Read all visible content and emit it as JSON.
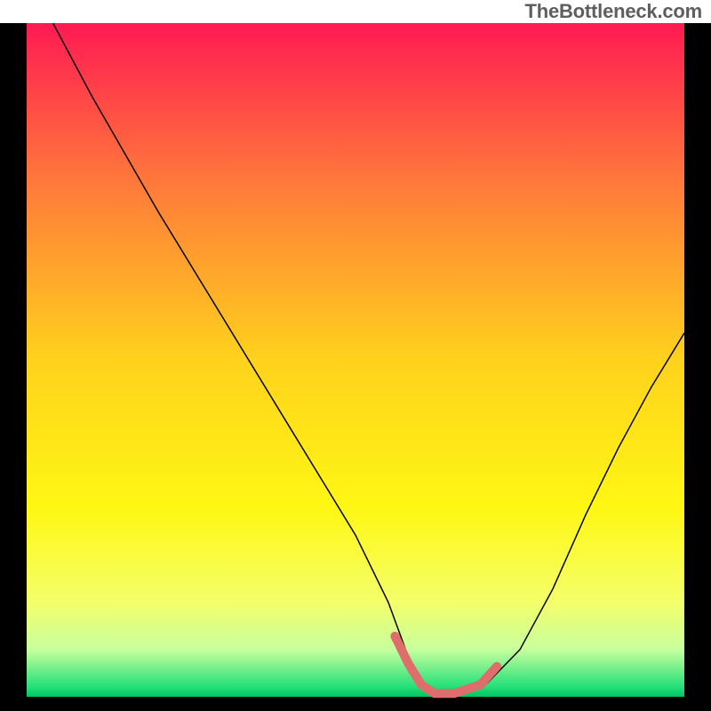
{
  "attribution": "TheBottleneck.com",
  "chart_data": {
    "type": "line",
    "title": "",
    "xlabel": "",
    "ylabel": "",
    "xlim": [
      0,
      100
    ],
    "ylim": [
      0,
      100
    ],
    "grid": false,
    "legend": false,
    "annotations": [],
    "background_gradient": {
      "stops": [
        {
          "offset": 0.0,
          "color": "#ff1a53"
        },
        {
          "offset": 0.25,
          "color": "#ff7e39"
        },
        {
          "offset": 0.5,
          "color": "#ffd21c"
        },
        {
          "offset": 0.72,
          "color": "#fff714"
        },
        {
          "offset": 0.86,
          "color": "#f4ff6a"
        },
        {
          "offset": 0.93,
          "color": "#c7ff9e"
        },
        {
          "offset": 0.985,
          "color": "#25e07a"
        },
        {
          "offset": 1.0,
          "color": "#00c463"
        }
      ]
    },
    "series": [
      {
        "name": "curve",
        "color": "#000000",
        "stroke_width": 1.5,
        "x": [
          4.0,
          10.0,
          20.0,
          30.0,
          40.0,
          50.0,
          55.0,
          58.0,
          60.0,
          62.0,
          65.0,
          70.0,
          75.0,
          80.0,
          85.0,
          90.0,
          95.0,
          100.0
        ],
        "y": [
          100.0,
          89.0,
          72.0,
          56.0,
          40.0,
          24.0,
          14.0,
          6.0,
          2.0,
          0.5,
          0.5,
          2.0,
          7.0,
          16.0,
          27.0,
          37.0,
          46.0,
          54.0
        ]
      },
      {
        "name": "flat-overlay",
        "color": "#de6d6c",
        "stroke_width": 10,
        "linecap": "round",
        "x": [
          56.0,
          58.0,
          60.0,
          62.0,
          65.0,
          69.0,
          71.5
        ],
        "y": [
          9.0,
          5.0,
          1.8,
          0.5,
          0.5,
          1.8,
          4.5
        ]
      }
    ]
  }
}
